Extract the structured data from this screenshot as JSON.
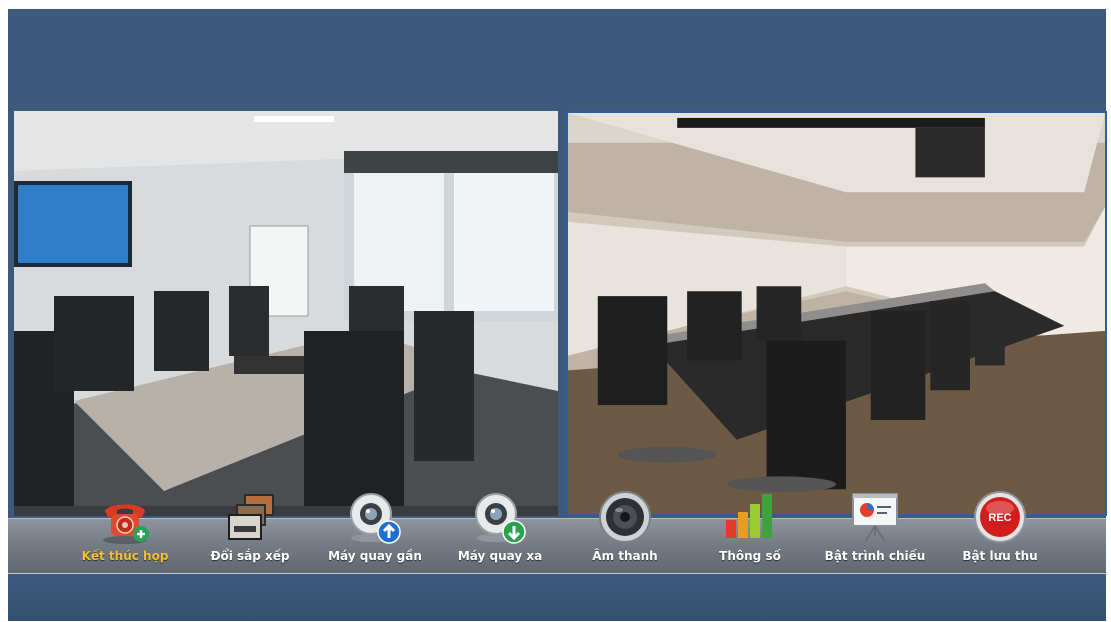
{
  "toolbar": {
    "items": [
      {
        "label": "Kết thúc họp",
        "icon": "phone-end-icon",
        "active": true
      },
      {
        "label": "Đổi sắp xếp",
        "icon": "layout-switch-icon",
        "active": false
      },
      {
        "label": "Máy quay gần",
        "icon": "camera-near-icon",
        "active": false
      },
      {
        "label": "Máy quay xa",
        "icon": "camera-far-icon",
        "active": false
      },
      {
        "label": "Âm thanh",
        "icon": "speaker-icon",
        "active": false
      },
      {
        "label": "Thông số",
        "icon": "statistics-icon",
        "active": false
      },
      {
        "label": "Bật trình chiếu",
        "icon": "presentation-icon",
        "active": false
      },
      {
        "label": "Bật lưu thu",
        "icon": "record-icon",
        "active": false
      }
    ],
    "active_label_color": "#f0c030",
    "label_color": "#ffffff",
    "record_badge": "REC"
  },
  "colors": {
    "background": "#3d5a7d",
    "toolbar": "#767c84",
    "selected_video_border": "#2f5ea0"
  }
}
